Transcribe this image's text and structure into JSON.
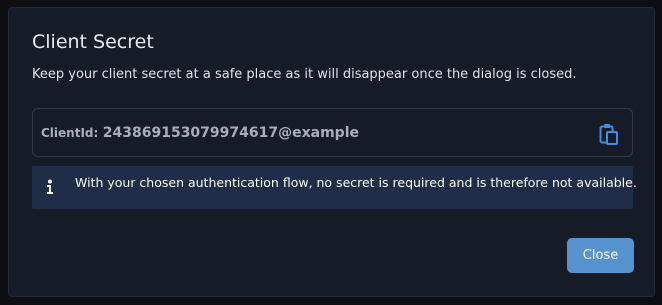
{
  "dialog": {
    "title": "Client Secret",
    "description": "Keep your client secret at a safe place as it will disappear once the dialog is closed.",
    "client": {
      "label": "ClientId:",
      "value": "243869153079974617@example",
      "copy_icon": "clipboard-icon"
    },
    "alert": {
      "icon": "info-icon",
      "text": "With your chosen authentication flow, no secret is required and is therefore not available."
    },
    "close_label": "Close"
  },
  "colors": {
    "backdrop": "#0c0e14",
    "dialog_bg": "#161b28",
    "alert_bg": "#1f2d48",
    "accent": "#5592cf",
    "icon_blue": "#3e8ee6"
  }
}
